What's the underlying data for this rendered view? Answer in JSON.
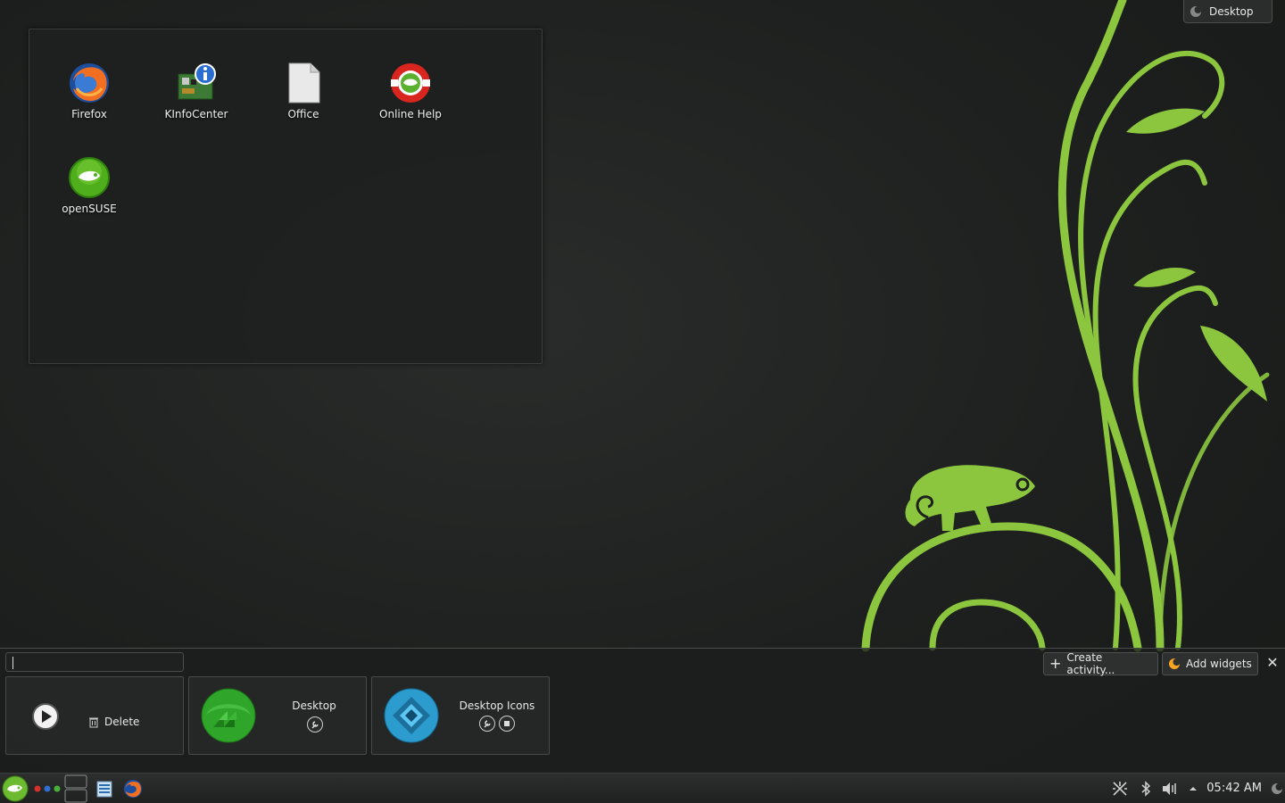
{
  "desktop": {
    "activity_label": "Desktop",
    "icons": [
      {
        "label": "Firefox",
        "icon": "firefox-icon"
      },
      {
        "label": "KInfoCenter",
        "icon": "kinfocenter-icon"
      },
      {
        "label": "Office",
        "icon": "office-document-icon"
      },
      {
        "label": "Online Help",
        "icon": "online-help-icon"
      },
      {
        "label": "openSUSE",
        "icon": "opensuse-icon"
      }
    ]
  },
  "widget_explorer": {
    "search_value": "",
    "create_activity_label": "Create activity...",
    "add_widgets_label": "Add widgets",
    "close_label": "✕",
    "activities": [
      {
        "title": "",
        "action_label": "Delete",
        "icon": "play-icon"
      },
      {
        "title": "Desktop",
        "icon": "desktop-activity-icon"
      },
      {
        "title": "Desktop Icons",
        "icon": "desktop-icons-activity-icon"
      }
    ]
  },
  "taskbar": {
    "clock": "05:42 AM",
    "items": [
      "opensuse-menu-icon",
      "activity-dots-icon",
      "pager-icon",
      "file-manager-icon",
      "firefox-icon"
    ],
    "tray": [
      "network-icon",
      "bluetooth-icon",
      "volume-icon",
      "tray-expand-icon",
      "cashew-icon"
    ]
  },
  "colors": {
    "accent_green": "#8cc63f",
    "background_dark": "#1e201f",
    "opensuse_green": "#73ba25"
  }
}
